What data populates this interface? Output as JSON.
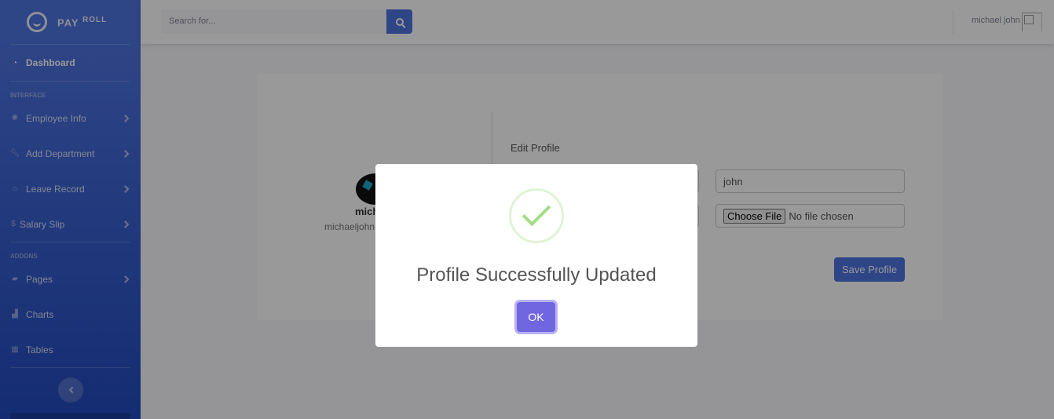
{
  "brand": {
    "name": "PAY",
    "sup": "ROLL"
  },
  "sidebar": {
    "dashboard": "Dashboard",
    "heading_interface": "INTERFACE",
    "items_interface": [
      {
        "label": "Employee Info",
        "icon": "gear-icon"
      },
      {
        "label": "Add Department",
        "icon": "wrench-icon"
      },
      {
        "label": "Leave Record",
        "icon": "home-icon"
      },
      {
        "label": "Salary Slip",
        "icon": "dollar-icon"
      }
    ],
    "heading_addons": "ADDONS",
    "items_addons": [
      {
        "label": "Pages",
        "icon": "folder-icon"
      },
      {
        "label": "Charts",
        "icon": "chart-icon"
      },
      {
        "label": "Tables",
        "icon": "table-icon"
      }
    ]
  },
  "topbar": {
    "search_placeholder": "Search for...",
    "user_name": "michael john"
  },
  "profile": {
    "name_partial": "mich",
    "email_partial": "michaeljohn",
    "edit_title": "Edit Profile",
    "last_name_value": "john",
    "file_button": "Choose File",
    "file_status": "No file chosen",
    "save_label": "Save Profile"
  },
  "modal": {
    "title": "Profile Successfully Updated",
    "ok_label": "OK"
  },
  "colors": {
    "primary": "#4e73df",
    "success": "#a5dc86",
    "confirm": "#7066e0"
  }
}
